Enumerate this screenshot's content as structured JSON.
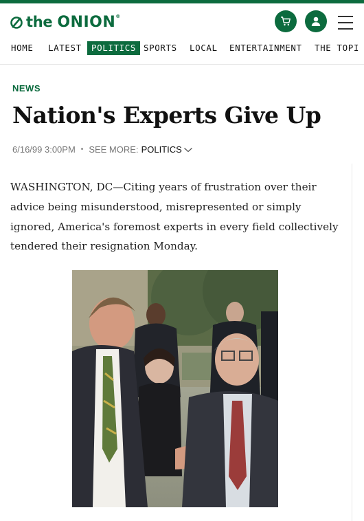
{
  "site": {
    "logo_prefix": "the",
    "logo_name": "ONION",
    "reg_mark": "®"
  },
  "nav": {
    "items": [
      "HOME",
      "LATEST",
      "POLITICS",
      "SPORTS",
      "LOCAL",
      "ENTERTAINMENT",
      "THE TOPI"
    ],
    "active": "POLITICS"
  },
  "article": {
    "kicker": "NEWS",
    "headline": "Nation's Experts Give Up",
    "date": "6/16/99 3:00PM",
    "separator": "•",
    "see_more_label": "SEE MORE:",
    "section": "POLITICS",
    "body": "WASHINGTON, DC—Citing years of frustration over their advice being misunderstood, misrepresented or simply ignored, America's foremost experts in every field collectively tendered their resignation Monday."
  },
  "colors": {
    "brand_green": "#0c6b3e"
  },
  "icons": {
    "logo": "onion-logo-icon",
    "cart": "cart-icon",
    "user": "user-icon",
    "menu": "hamburger-menu-icon",
    "chevron": "chevron-down-icon"
  }
}
